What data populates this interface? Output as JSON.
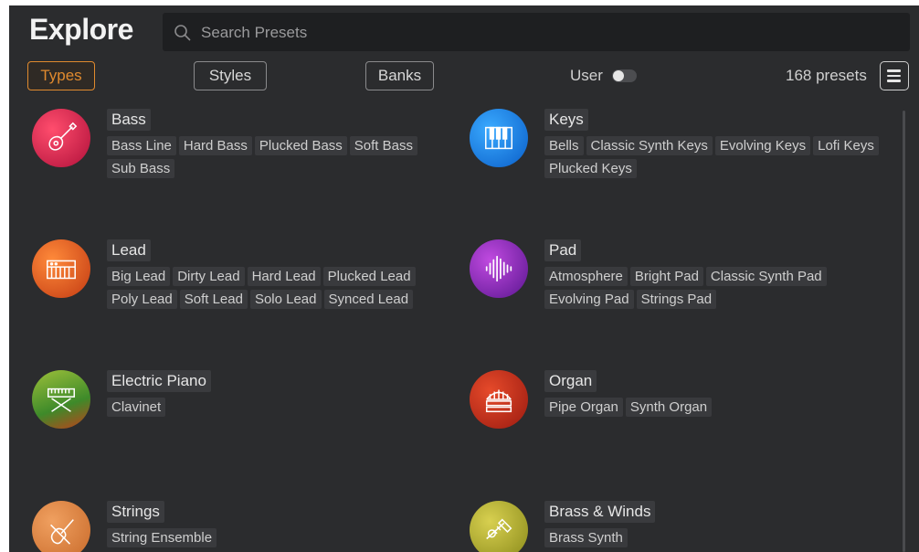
{
  "header": {
    "title": "Explore",
    "search_placeholder": "Search Presets"
  },
  "filters": {
    "types": "Types",
    "styles": "Styles",
    "banks": "Banks",
    "user_label": "User",
    "user_toggle_on": false,
    "preset_count": "168 presets"
  },
  "categories": [
    {
      "name": "Bass",
      "icon": "guitar-icon",
      "tags": [
        "Bass Line",
        "Hard Bass",
        "Plucked Bass",
        "Soft Bass",
        "Sub Bass"
      ]
    },
    {
      "name": "Keys",
      "icon": "piano-keys-icon",
      "tags": [
        "Bells",
        "Classic Synth Keys",
        "Evolving Keys",
        "Lofi Keys",
        "Plucked Keys"
      ]
    },
    {
      "name": "Lead",
      "icon": "synth-keyboard-icon",
      "tags": [
        "Big Lead",
        "Dirty Lead",
        "Hard Lead",
        "Plucked Lead",
        "Poly Lead",
        "Soft Lead",
        "Solo Lead",
        "Synced Lead"
      ]
    },
    {
      "name": "Pad",
      "icon": "waveform-icon",
      "tags": [
        "Atmosphere",
        "Bright Pad",
        "Classic Synth Pad",
        "Evolving Pad",
        "Strings Pad"
      ]
    },
    {
      "name": "Electric Piano",
      "icon": "keyboard-stand-icon",
      "tags": [
        "Clavinet"
      ]
    },
    {
      "name": "Organ",
      "icon": "pipe-organ-icon",
      "tags": [
        "Pipe Organ",
        "Synth Organ"
      ]
    },
    {
      "name": "Strings",
      "icon": "violin-icon",
      "tags": [
        "String Ensemble"
      ]
    },
    {
      "name": "Brass & Winds",
      "icon": "trumpet-icon",
      "tags": [
        "Brass Synth"
      ]
    }
  ],
  "colors": {
    "background": "#2b2c2e",
    "accent": "#e08a2e"
  }
}
